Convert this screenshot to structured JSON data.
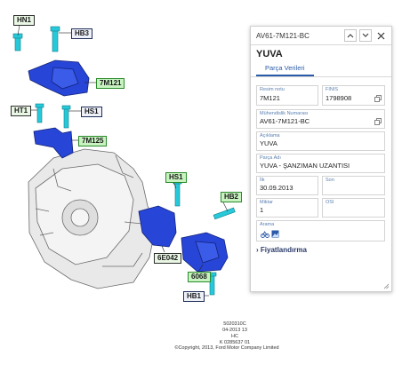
{
  "diagram": {
    "callouts": {
      "hn1": "HN1",
      "hb3": "HB3",
      "c7m121": "7M121",
      "ht1": "HT1",
      "hs1a": "HS1",
      "c7m125": "7M125",
      "hs1b": "HS1",
      "hb2": "HB2",
      "c6e042": "6E042",
      "c6068": "6068",
      "hb1": "HB1"
    },
    "footer": {
      "code1": "5020310C",
      "date": "04-2013 13",
      "hc": "HC",
      "kcode": "K 0285637 01",
      "copyright": "©Copyright, 2013, Ford Motor Company Limited"
    }
  },
  "panel": {
    "header_title": "AV61-7M121-BC",
    "part_name": "YUVA",
    "tab_label": "Parça Verileri",
    "fields": {
      "drawing_no": {
        "label": "Resim notu",
        "value": "7M121"
      },
      "finis": {
        "label": "FINIS",
        "value": "1798908"
      },
      "engineering_no": {
        "label": "Mühendislik Numarası",
        "value": "AV61-7M121-BC"
      },
      "description": {
        "label": "Açıklama",
        "value": "YUVA"
      },
      "part_name": {
        "label": "Parça Adı",
        "value": "YUVA - ŞANZIMAN UZANTISI"
      },
      "start": {
        "label": "İlk",
        "value": "30.09.2013"
      },
      "end": {
        "label": "Son",
        "value": ""
      },
      "quantity": {
        "label": "Miktar",
        "value": "1"
      },
      "osi": {
        "label": "OSI",
        "value": ""
      },
      "search": {
        "label": "Arama"
      }
    },
    "pricing_label": "Fiyatlandırma"
  },
  "colors": {
    "bracket_blue": "#2745d6",
    "bolt_cyan": "#27c9d9",
    "accent_blue": "#2a5ba8"
  }
}
